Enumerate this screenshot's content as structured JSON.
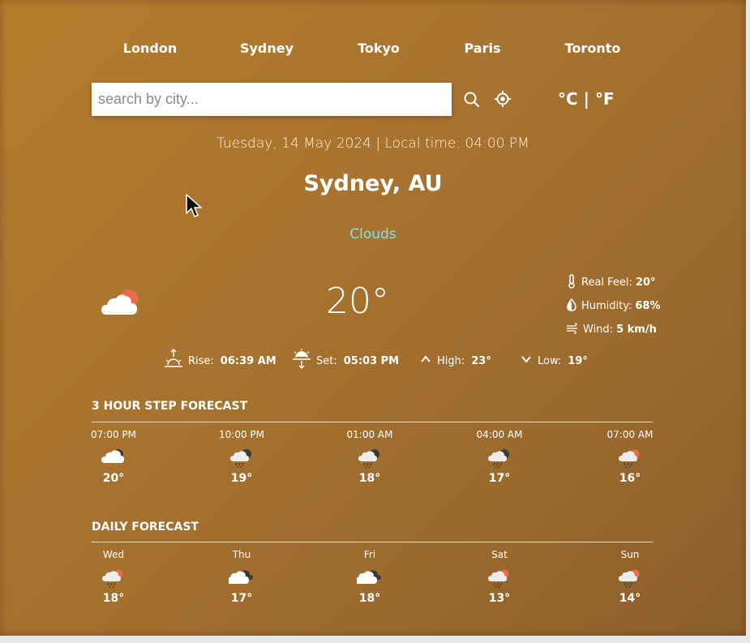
{
  "cities": [
    "London",
    "Sydney",
    "Tokyo",
    "Paris",
    "Toronto"
  ],
  "search": {
    "placeholder": "search by city..."
  },
  "icons": {
    "search": "search-icon",
    "location": "location-icon",
    "main_weather": "cloud-sun-icon"
  },
  "units": {
    "celsius": "°C",
    "separator": "|",
    "fahrenheit": "°F"
  },
  "datetime": "Tuesday, 14 May 2024 | Local time: 04:00 PM",
  "location": "Sydney, AU",
  "condition": "Clouds",
  "temperature": "20°",
  "details": {
    "real_feel_label": "Real Feel:",
    "real_feel_value": "20°",
    "humidity_label": "Humidity:",
    "humidity_value": "68%",
    "wind_label": "Wind:",
    "wind_value": "5 km/h"
  },
  "sun": {
    "rise_label": "Rise:",
    "rise_value": "06:39 AM",
    "set_label": "Set:",
    "set_value": "05:03 PM",
    "high_label": "High:",
    "high_value": "23°",
    "low_label": "Low:",
    "low_value": "19°"
  },
  "hourly": {
    "title": "3 hour step forecast",
    "items": [
      {
        "time": "07:00 PM",
        "temp": "20°",
        "icon": "cloud-moon-icon"
      },
      {
        "time": "10:00 PM",
        "temp": "19°",
        "icon": "cloud-moon-rain-icon"
      },
      {
        "time": "01:00 AM",
        "temp": "18°",
        "icon": "cloud-moon-rain-icon"
      },
      {
        "time": "04:00 AM",
        "temp": "17°",
        "icon": "cloud-moon-rain-icon"
      },
      {
        "time": "07:00 AM",
        "temp": "16°",
        "icon": "cloud-sun-rain-icon"
      }
    ]
  },
  "daily": {
    "title": "Daily forecast",
    "items": [
      {
        "day": "Wed",
        "temp": "18°",
        "icon": "cloud-sun-rain-icon"
      },
      {
        "day": "Thu",
        "temp": "17°",
        "icon": "clouds-icon"
      },
      {
        "day": "Fri",
        "temp": "18°",
        "icon": "clouds-icon"
      },
      {
        "day": "Sat",
        "temp": "13°",
        "icon": "cloud-sun-rain-icon"
      },
      {
        "day": "Sun",
        "temp": "14°",
        "icon": "cloud-sun-rain-icon"
      }
    ]
  },
  "colors": {
    "background": "#a8732f",
    "condition": "#7fe3e9",
    "sun": "#ee6a4c"
  }
}
